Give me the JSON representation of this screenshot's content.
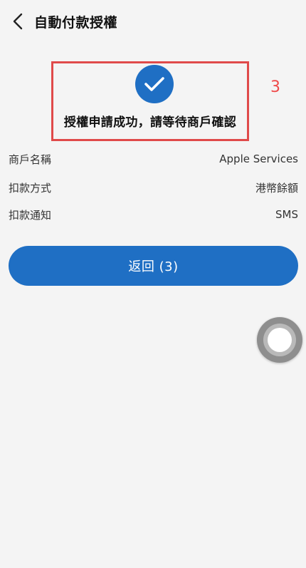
{
  "header": {
    "title": "自動付款授權"
  },
  "success": {
    "message": "授權申請成功，請等待商戶確認",
    "annotation": "3"
  },
  "details": [
    {
      "label": "商戶名稱",
      "value": "Apple Services"
    },
    {
      "label": "扣款方式",
      "value": "港幣餘額"
    },
    {
      "label": "扣款通知",
      "value": "SMS"
    }
  ],
  "actions": {
    "return_label": "返回 (3)"
  },
  "colors": {
    "primary": "#1f6fc4",
    "highlight_border": "#e04a4a",
    "background": "#f4f4f4"
  }
}
